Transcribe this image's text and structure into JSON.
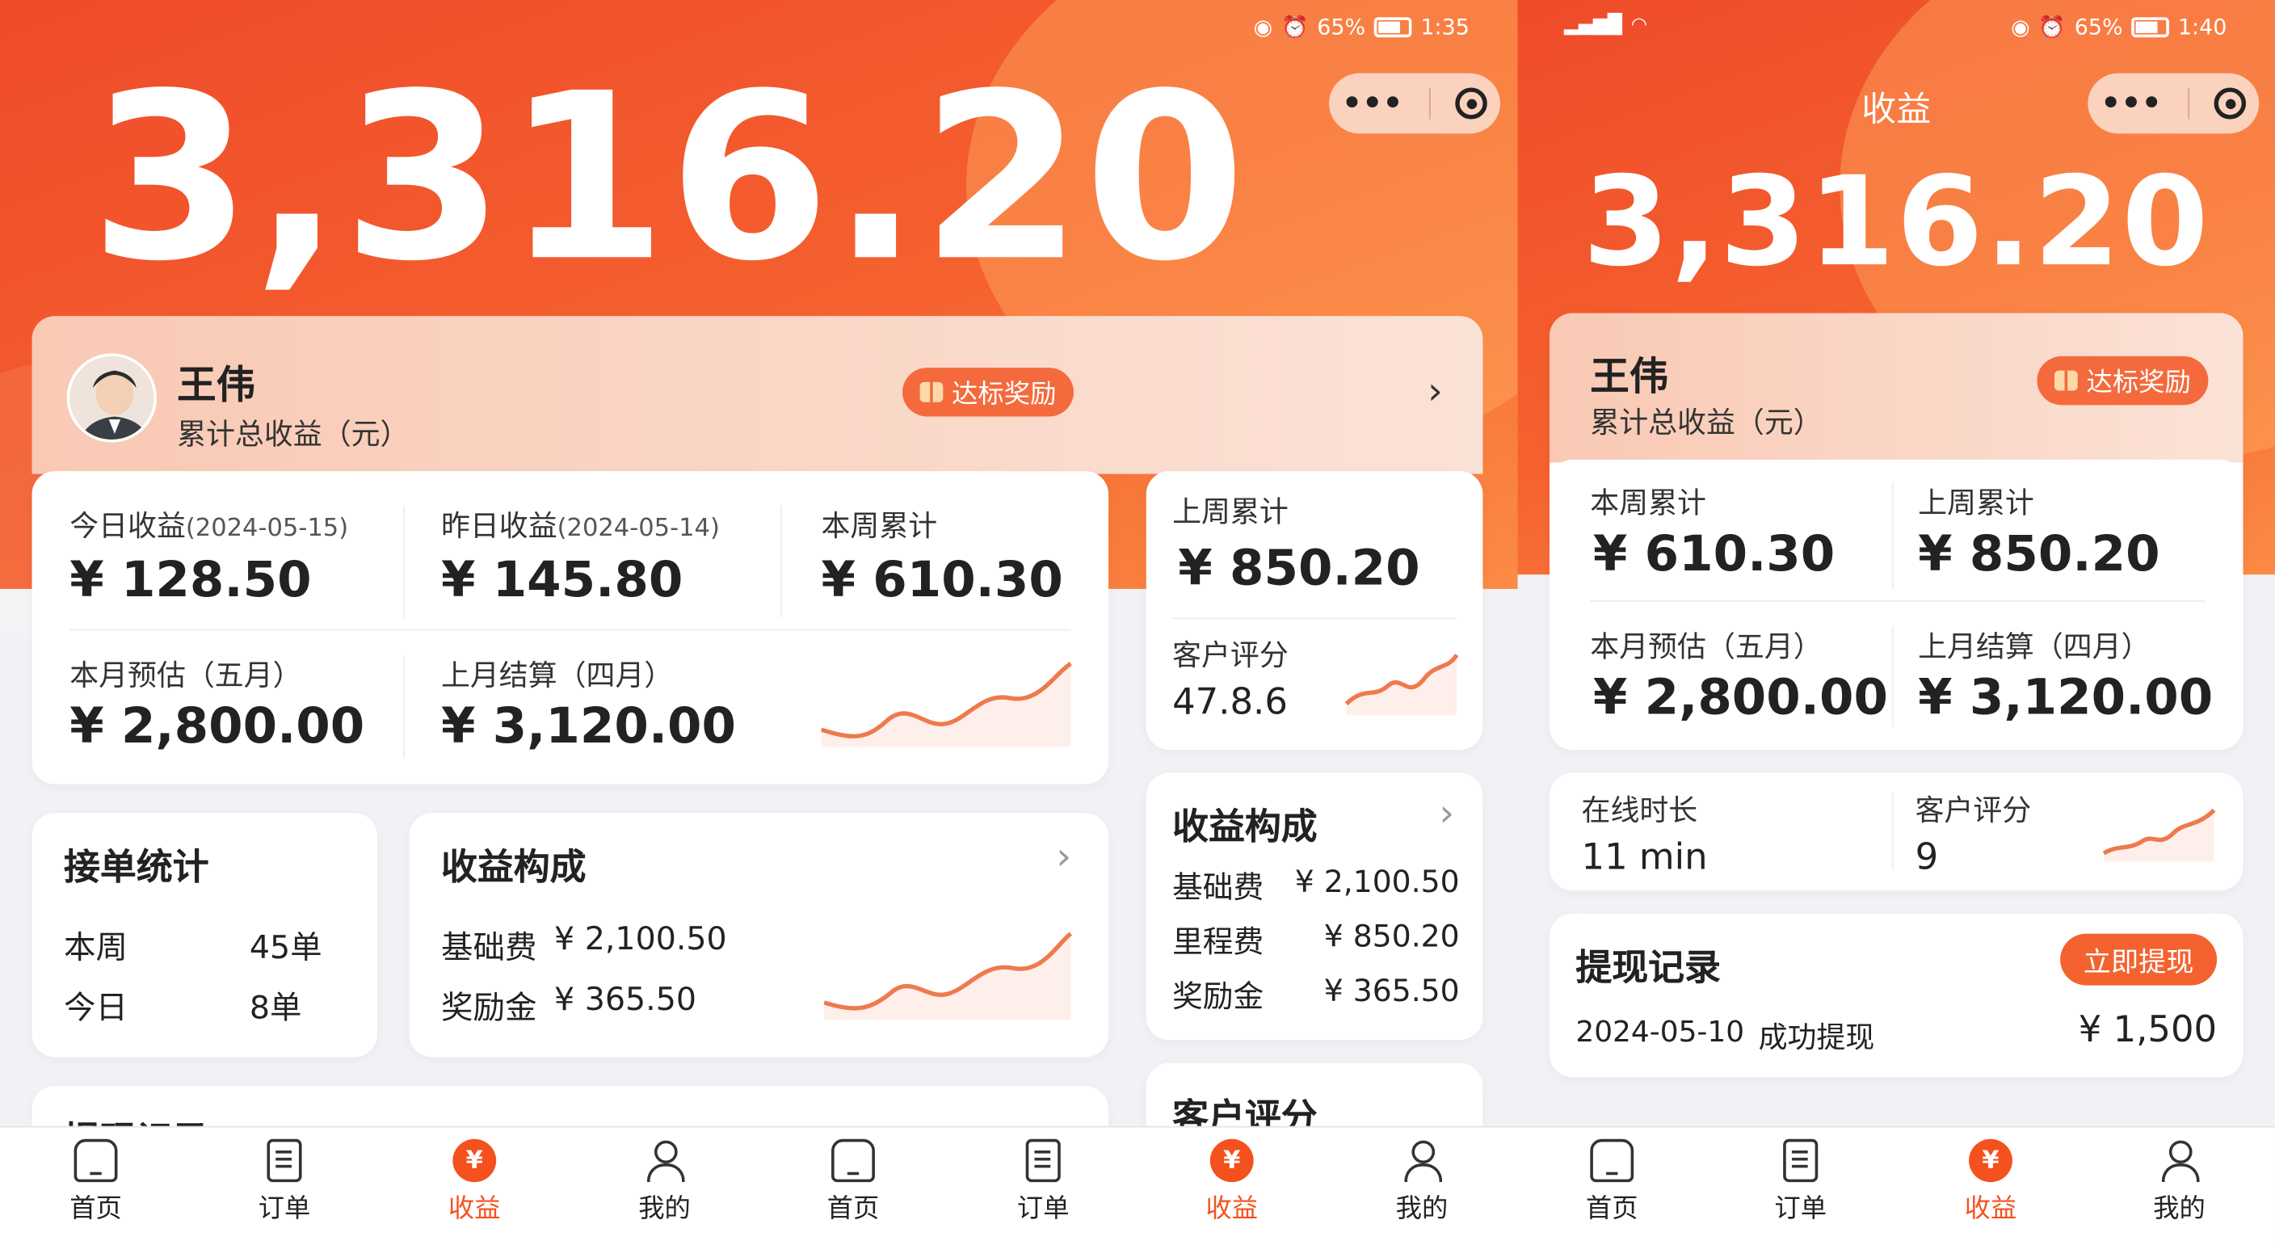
{
  "screen_a": {
    "status": {
      "percent": "65%",
      "time": "1:35"
    },
    "total": "3,316.20",
    "user": {
      "name": "王伟",
      "subtitle": "累计总收益（元）",
      "badge": "达标奖励"
    },
    "stats": {
      "today": {
        "label": "今日收益",
        "date": "(2024-05-15)",
        "value": "¥ 128.50"
      },
      "yesterday": {
        "label": "昨日收益",
        "date": "(2024-05-14)",
        "value": "¥ 145.80"
      },
      "week": {
        "label": "本周累计",
        "value": "¥ 610.30"
      },
      "month_est": {
        "label": "本月预估（五月）",
        "value": "¥ 2,800.00"
      },
      "last_month": {
        "label": "上月结算（四月）",
        "value": "¥ 3,120.00"
      }
    },
    "side": {
      "last_week_label": "上周累计",
      "last_week_value": "¥ 850.20",
      "rating_label": "客户评分",
      "rating_value": "47.8.6"
    },
    "orders": {
      "title": "接单统计",
      "week_label": "本周",
      "week_value": "45单",
      "today_label": "今日",
      "today_value": "8单"
    },
    "comp": {
      "title": "收益构成",
      "base_label": "基础费",
      "base_value": "¥ 2,100.50",
      "bonus_label": "奖励金",
      "bonus_value": "¥ 365.50"
    },
    "comp2": {
      "title": "收益构成",
      "base_label": "基础费",
      "base_value": "¥ 2,100.50",
      "mileage_label": "里程费",
      "mileage_value": "¥ 850.20",
      "bonus_label": "奖励金",
      "bonus_value": "¥ 365.50"
    },
    "cut": {
      "withdraw_title": "提现记录",
      "rating_title": "客户评分"
    }
  },
  "screen_b": {
    "status": {
      "percent": "65%",
      "time": "1:40"
    },
    "page_title": "收益",
    "total": "3,316.20",
    "user": {
      "name": "王伟",
      "subtitle": "累计总收益（元）",
      "badge": "达标奖励"
    },
    "stats": {
      "week": {
        "label": "本周累计",
        "value": "¥ 610.30"
      },
      "last_week": {
        "label": "上周累计",
        "value": "¥ 850.20"
      },
      "month_est": {
        "label": "本月预估（五月）",
        "value": "¥ 2,800.00"
      },
      "last_month": {
        "label": "上月结算（四月）",
        "value": "¥ 3,120.00"
      }
    },
    "online": {
      "label": "在线时长",
      "value": "11 min",
      "rating_label": "客户评分",
      "rating_value": "9"
    },
    "withdraw": {
      "title": "提现记录",
      "button": "立即提现",
      "date": "2024-05-10",
      "status": "成功提现",
      "amount": "¥ 1,500"
    }
  },
  "nav": {
    "home": "首页",
    "orders": "订单",
    "earnings": "收益",
    "mine": "我的"
  },
  "colors": {
    "primary": "#f4511e",
    "header_start": "#ef4b2a",
    "header_end": "#fb8b44",
    "spark": "#ee7a4e"
  },
  "icons": [
    "eye-icon",
    "alarm-icon",
    "battery-icon",
    "signal-icon",
    "wifi-icon",
    "more-icon",
    "target-icon",
    "gift-icon",
    "chevron-right-icon",
    "home-icon",
    "order-icon",
    "yen-icon",
    "user-icon"
  ]
}
